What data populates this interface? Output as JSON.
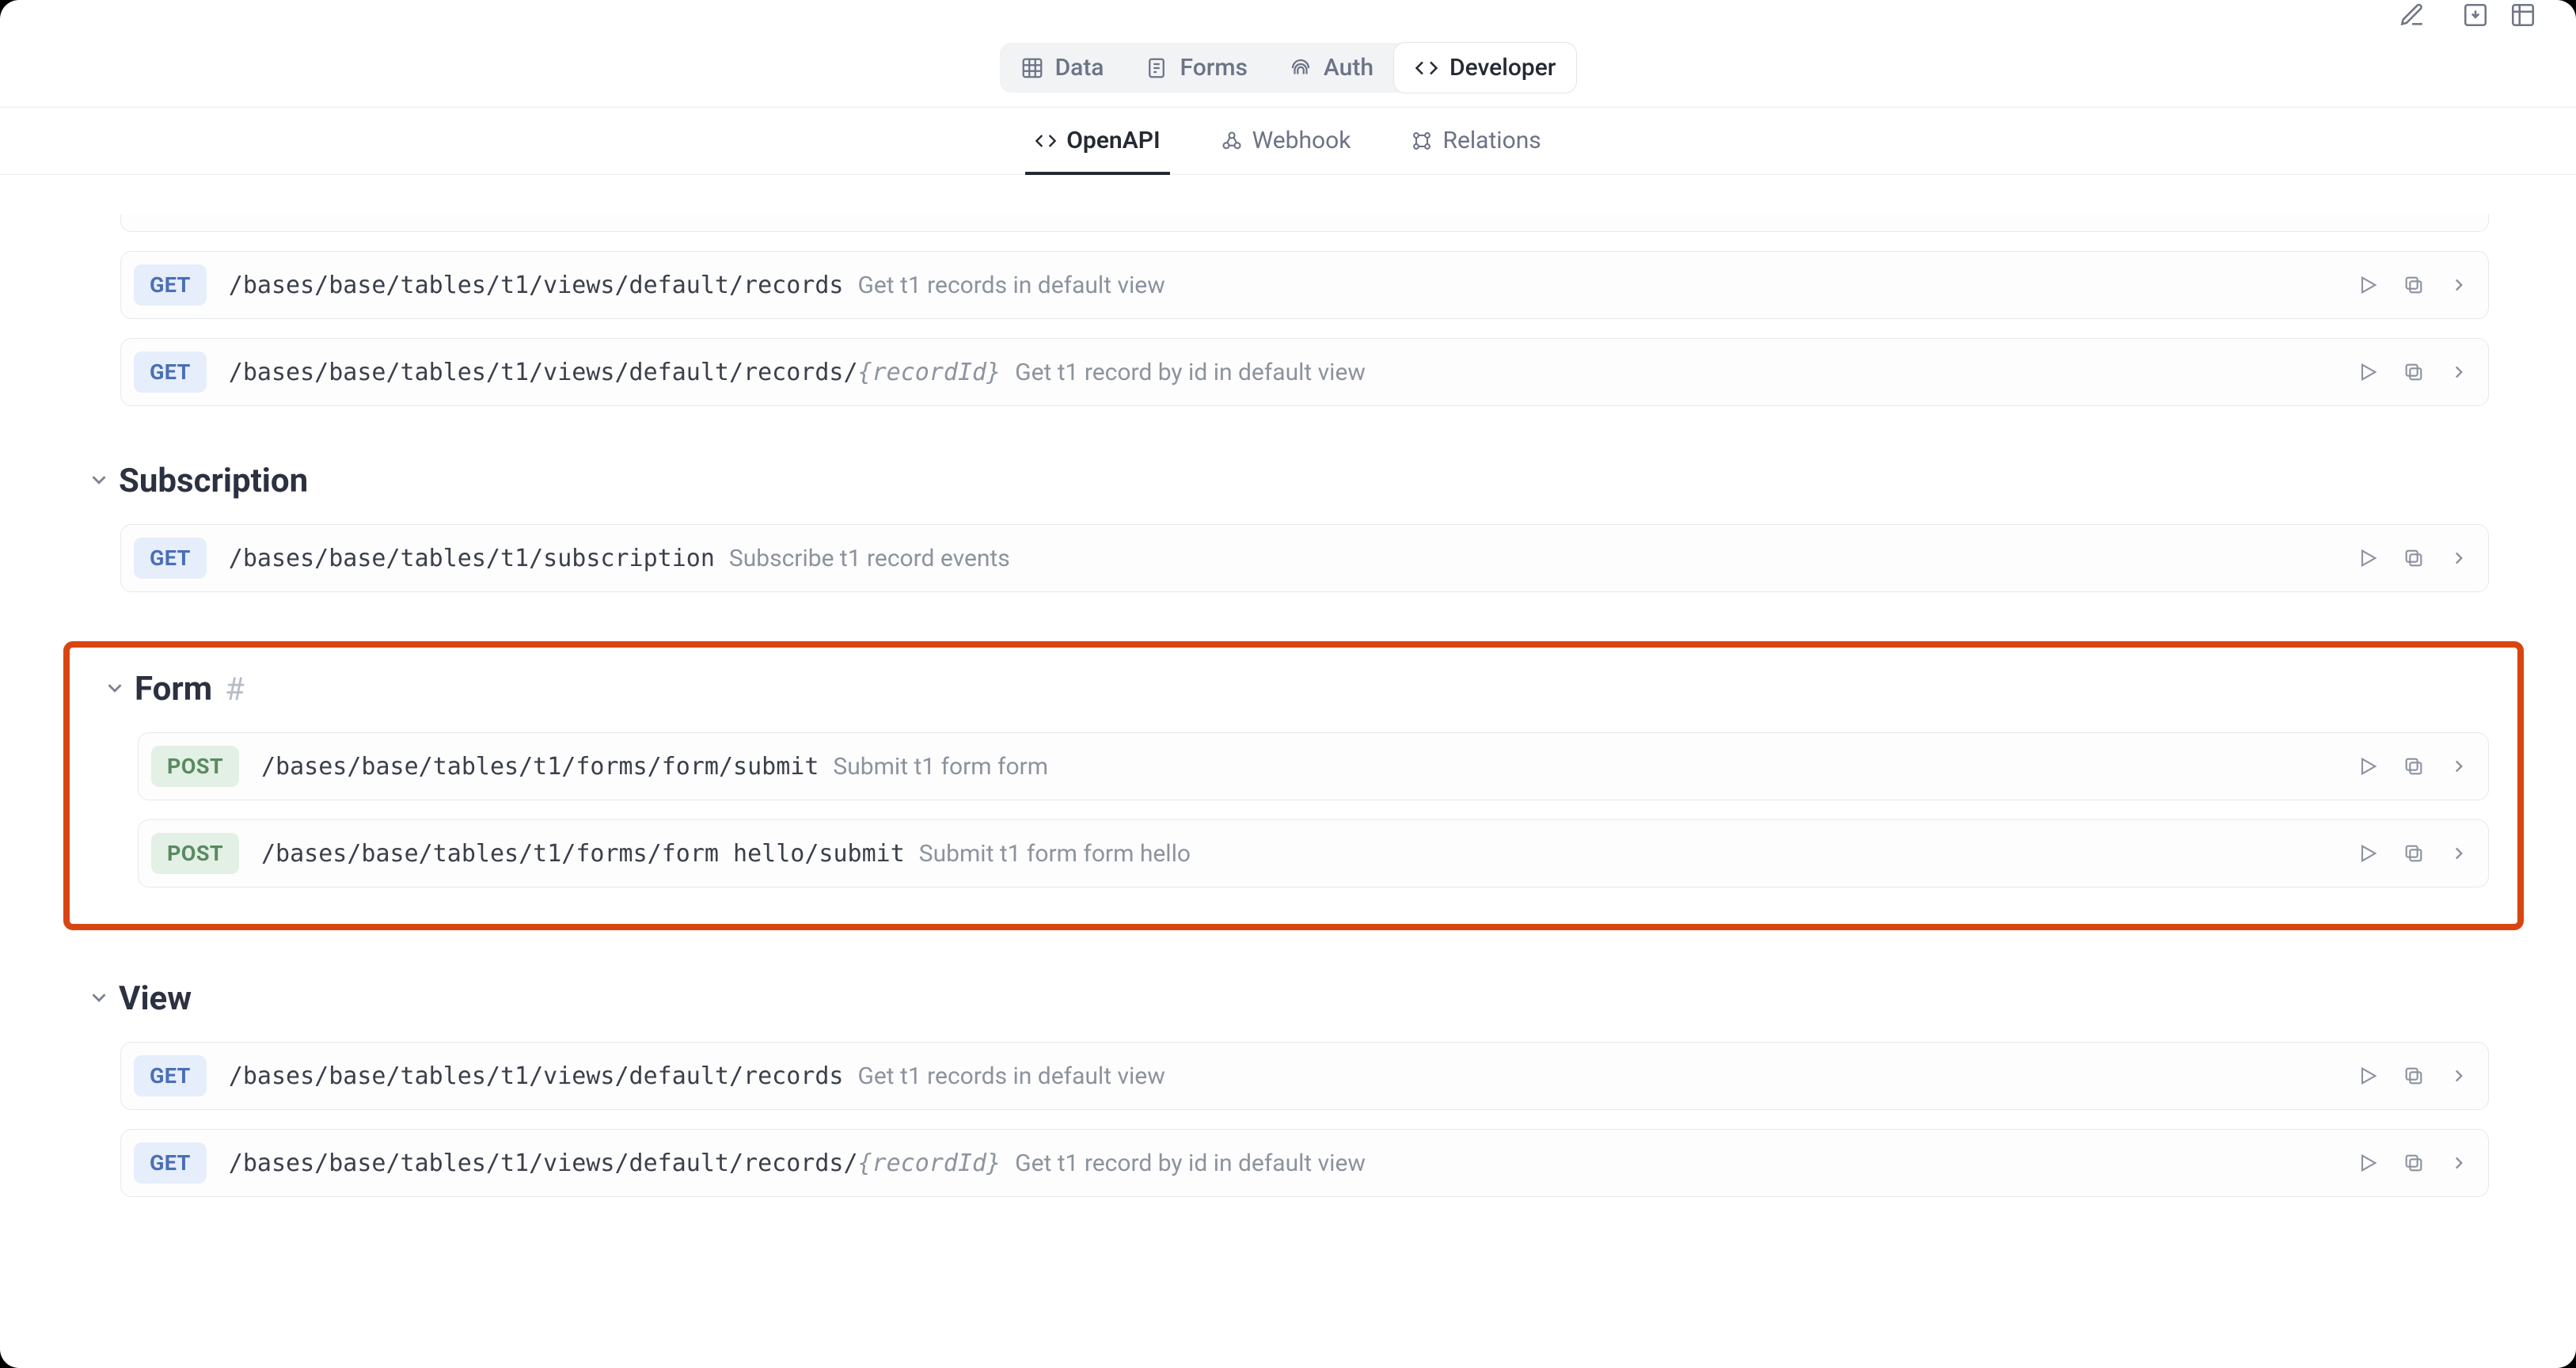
{
  "primary_tabs": {
    "data": "Data",
    "forms": "Forms",
    "auth": "Auth",
    "developer": "Developer",
    "active": "developer"
  },
  "sub_tabs": {
    "openapi": "OpenAPI",
    "webhook": "Webhook",
    "relations": "Relations",
    "active": "openapi"
  },
  "sections": [
    {
      "id": "top",
      "title": "",
      "highlight": false,
      "endpoints": [
        {
          "method": "GET",
          "path": "/bases/base/tables/t1/views/default/records",
          "param": "",
          "desc": "Get t1 records in default view"
        },
        {
          "method": "GET",
          "path": "/bases/base/tables/t1/views/default/records/",
          "param": "{recordId}",
          "desc": "Get t1 record by id in default view"
        }
      ]
    },
    {
      "id": "subscription",
      "title": "Subscription",
      "highlight": false,
      "endpoints": [
        {
          "method": "GET",
          "path": "/bases/base/tables/t1/subscription",
          "param": "",
          "desc": "Subscribe t1 record events"
        }
      ]
    },
    {
      "id": "form",
      "title": "Form",
      "hash": "#",
      "highlight": true,
      "endpoints": [
        {
          "method": "POST",
          "path": "/bases/base/tables/t1/forms/form/submit",
          "param": "",
          "desc": "Submit t1 form form"
        },
        {
          "method": "POST",
          "path": "/bases/base/tables/t1/forms/form hello/submit",
          "param": "",
          "desc": "Submit t1 form form hello"
        }
      ]
    },
    {
      "id": "view",
      "title": "View",
      "highlight": false,
      "endpoints": [
        {
          "method": "GET",
          "path": "/bases/base/tables/t1/views/default/records",
          "param": "",
          "desc": "Get t1 records in default view"
        },
        {
          "method": "GET",
          "path": "/bases/base/tables/t1/views/default/records/",
          "param": "{recordId}",
          "desc": "Get t1 record by id in default view"
        }
      ]
    }
  ]
}
